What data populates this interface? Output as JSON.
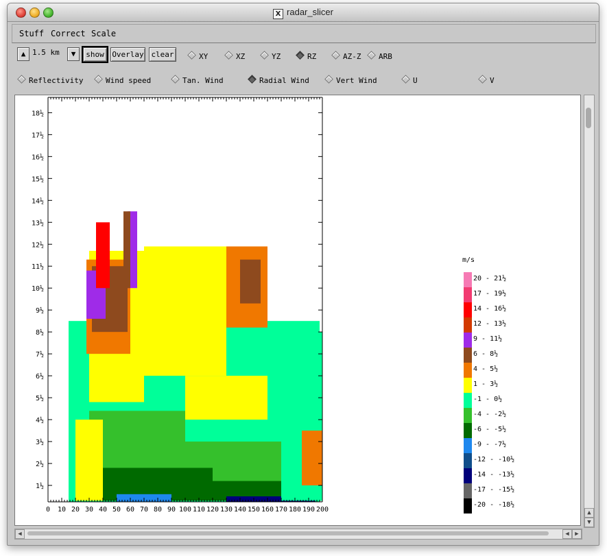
{
  "window": {
    "title": "radar_slicer"
  },
  "menu": [
    "Stuff",
    "Correct",
    "Scale"
  ],
  "toolbar": {
    "level": "1.5 km",
    "up_icon": "up-arrow-icon",
    "down_icon": "down-arrow-icon",
    "buttons": {
      "show": "show",
      "overlay": "Overlay",
      "clear": "clear"
    },
    "views": [
      {
        "label": "XY",
        "selected": false
      },
      {
        "label": "XZ",
        "selected": false
      },
      {
        "label": "YZ",
        "selected": false
      },
      {
        "label": "RZ",
        "selected": true
      },
      {
        "label": "AZ-Z",
        "selected": false
      },
      {
        "label": "ARB",
        "selected": false
      }
    ],
    "fields": [
      {
        "label": "Reflectivity",
        "selected": false
      },
      {
        "label": "Wind speed",
        "selected": false
      },
      {
        "label": "Tan. Wind",
        "selected": false
      },
      {
        "label": "Radial Wind",
        "selected": true
      },
      {
        "label": "Vert Wind",
        "selected": false
      },
      {
        "label": "U",
        "selected": false
      },
      {
        "label": "V",
        "selected": false
      }
    ]
  },
  "chart_data": {
    "type": "heatmap",
    "x_ticks": [
      "0",
      "10",
      "20",
      "30",
      "40",
      "50",
      "60",
      "70",
      "80",
      "90",
      "100",
      "110",
      "120",
      "130",
      "140",
      "150",
      "160",
      "170",
      "180",
      "190",
      "200"
    ],
    "xlim": [
      0,
      200
    ],
    "y_ticks": [
      "1½",
      "2½",
      "3½",
      "4½",
      "5½",
      "6½",
      "7½",
      "8½",
      "9½",
      "10½",
      "11½",
      "12½",
      "13½",
      "14½",
      "15½",
      "16½",
      "17½",
      "18½"
    ],
    "ylim": [
      0.25,
      18.7
    ],
    "legend": {
      "title": "m/s",
      "items": [
        {
          "label": "20 - 21½",
          "color": "#f67ab4"
        },
        {
          "label": "17 - 19½",
          "color": "#f23b71"
        },
        {
          "label": "14 - 16½",
          "color": "#ff0000"
        },
        {
          "label": "12 - 13½",
          "color": "#d33a00"
        },
        {
          "label": "9 - 11½",
          "color": "#9f2be8"
        },
        {
          "label": "6 - 8½",
          "color": "#8e4a1e"
        },
        {
          "label": "4 - 5½",
          "color": "#f07800"
        },
        {
          "label": "1 - 3½",
          "color": "#ffff00"
        },
        {
          "label": "-1 - 0½",
          "color": "#00ff99"
        },
        {
          "label": "-4 - -2½",
          "color": "#35c02c"
        },
        {
          "label": "-6 - -5½",
          "color": "#006a00"
        },
        {
          "label": "-9 - -7½",
          "color": "#1e88ee"
        },
        {
          "label": "-12 - -10½",
          "color": "#104e8b"
        },
        {
          "label": "-14 - -13½",
          "color": "#00007a"
        },
        {
          "label": "-17 - -15½",
          "color": "#666666"
        },
        {
          "label": "-20 - -18½",
          "color": "#000000"
        }
      ]
    }
  }
}
